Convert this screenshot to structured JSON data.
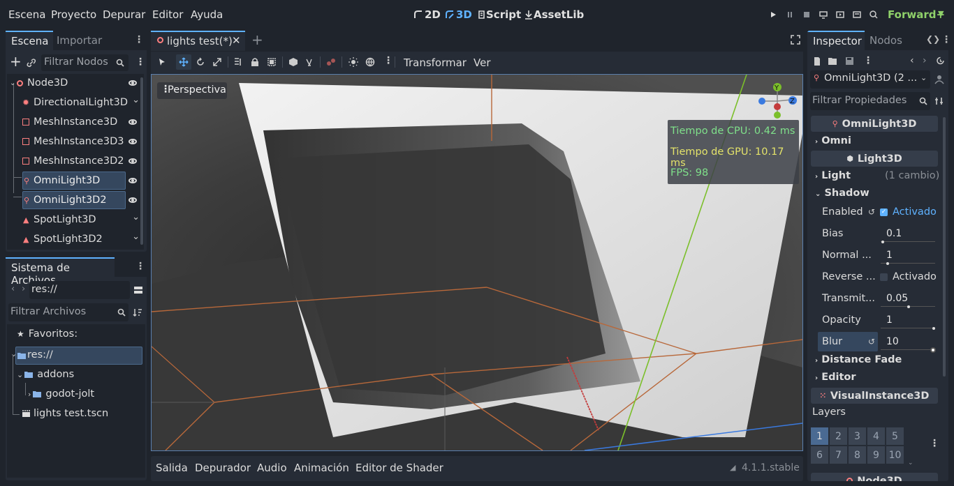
{
  "menu": {
    "escena": "Escena",
    "proyecto": "Proyecto",
    "depurar": "Depurar",
    "editor": "Editor",
    "ayuda": "Ayuda"
  },
  "workspaces": {
    "w2d": "2D",
    "w3d": "3D",
    "script": "Script",
    "assetlib": "AssetLib"
  },
  "renderer": "Forward+",
  "scene_dock": {
    "tab_scene": "Escena",
    "tab_import": "Importar",
    "filter_placeholder": "Filtrar Nodos",
    "nodes": [
      {
        "label": "Node3D",
        "icon": "node3d-icon"
      },
      {
        "label": "DirectionalLight3D",
        "icon": "directional-light-icon"
      },
      {
        "label": "MeshInstance3D",
        "icon": "mesh-instance-icon"
      },
      {
        "label": "MeshInstance3D3",
        "icon": "mesh-instance-icon"
      },
      {
        "label": "MeshInstance3D2",
        "icon": "mesh-instance-icon"
      },
      {
        "label": "OmniLight3D",
        "icon": "omni-light-icon"
      },
      {
        "label": "OmniLight3D2",
        "icon": "omni-light-icon"
      },
      {
        "label": "SpotLight3D",
        "icon": "spot-light-icon"
      },
      {
        "label": "SpotLight3D2",
        "icon": "spot-light-icon"
      }
    ]
  },
  "filesystem": {
    "title": "Sistema de Archivos",
    "path": "res://",
    "filter_placeholder": "Filtrar Archivos",
    "favorites": "Favoritos:",
    "root": "res://",
    "addons": "addons",
    "godot_jolt": "godot-jolt",
    "scene_file": "lights test.tscn"
  },
  "editor": {
    "tab": "lights test(*)",
    "transformar": "Transformar",
    "ver": "Ver",
    "perspective": "Perspectiva",
    "cpu": "Tiempo de CPU: 0.42 ms",
    "gpu": "Tiempo de GPU: 10.17 ms",
    "fps": "FPS: 98",
    "gizmo_y": "Y",
    "gizmo_z": "Z"
  },
  "bottom": {
    "salida": "Salida",
    "depurador": "Depurador",
    "audio": "Audio",
    "animacion": "Animación",
    "shader": "Editor de Shader",
    "version": "4.1.1.stable"
  },
  "inspector": {
    "tab_inspector": "Inspector",
    "tab_nodos": "Nodos",
    "object": "OmniLight3D (2 ...",
    "filter_placeholder": "Filtrar Propiedades",
    "sec_omni": "OmniLight3D",
    "grp_omni": "Omni",
    "sec_light": "Light3D",
    "grp_light": "Light",
    "light_changes": "(1 cambio)",
    "grp_shadow": "Shadow",
    "enabled_label": "Enabled",
    "enabled_value": "Activado",
    "bias_label": "Bias",
    "bias_value": "0.1",
    "normal_label": "Normal ...",
    "normal_value": "1",
    "reverse_label": "Reverse ...",
    "reverse_value": "Activado",
    "transmit_label": "Transmit...",
    "transmit_value": "0.05",
    "opacity_label": "Opacity",
    "opacity_value": "1",
    "blur_label": "Blur",
    "blur_value": "10",
    "grp_distance": "Distance Fade",
    "grp_editor": "Editor",
    "sec_visual": "VisualInstance3D",
    "layers_label": "Layers",
    "layers": [
      "1",
      "2",
      "3",
      "4",
      "5",
      "6",
      "7",
      "8",
      "9",
      "10"
    ],
    "sec_node3d": "Node3D"
  },
  "colors": {
    "accent": "#5fb2ff",
    "bg": "#1f242c",
    "panel": "#262c36",
    "selection": "#35475e",
    "light_red": "#fc7f7f",
    "stats_green": "#7fe08a",
    "stats_yellow": "#e4e36a"
  }
}
